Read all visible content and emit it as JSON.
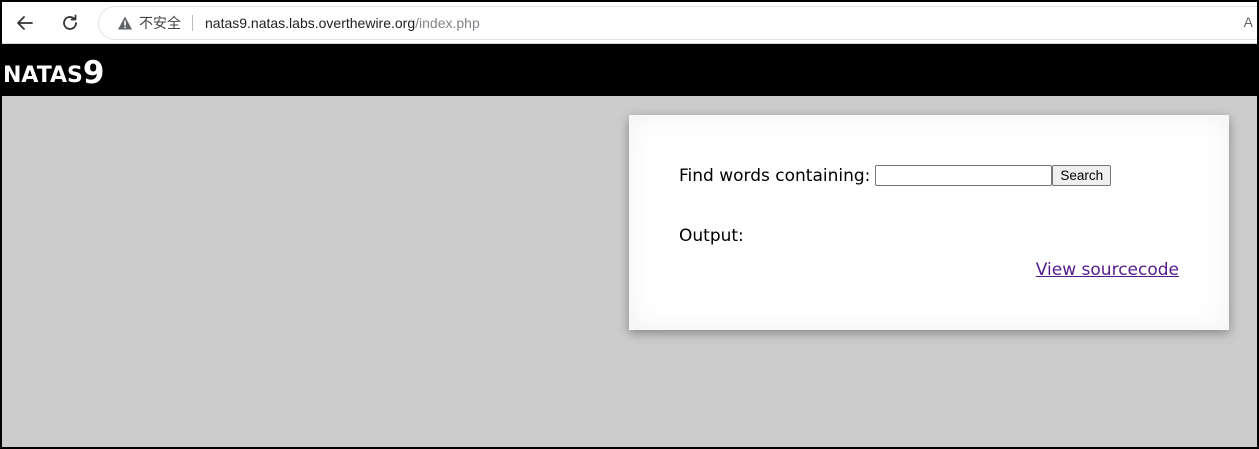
{
  "browser": {
    "security_label": "不安全",
    "url_host": "natas9.natas.labs.overthewire.org",
    "url_path": "/index.php",
    "reader_label": "A"
  },
  "page": {
    "title_prefix": "NATAS",
    "title_number": "9"
  },
  "form": {
    "find_label": "Find words containing:",
    "search_value": "",
    "search_button_label": "Search",
    "output_label": "Output:",
    "source_link_label": "View sourcecode"
  },
  "colors": {
    "header_bg": "#000000",
    "page_bg": "#cccccc",
    "link": "#551a8b"
  }
}
